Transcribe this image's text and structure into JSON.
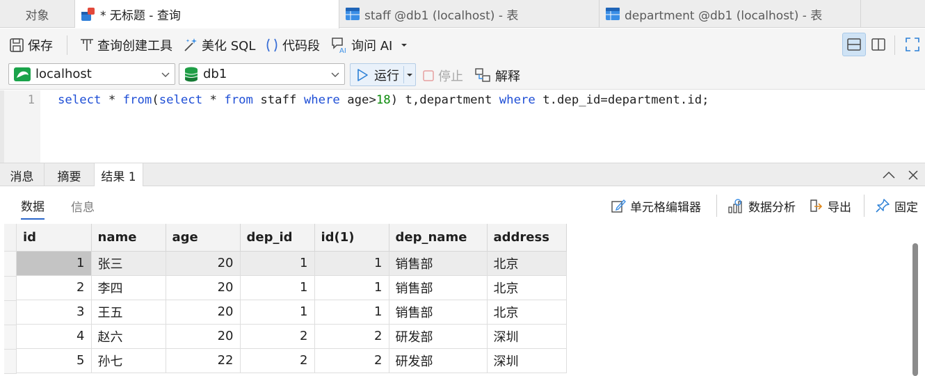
{
  "tabs": {
    "objects": "对象",
    "query": "* 无标题 - 查询",
    "staff": "staff @db1 (localhost) - 表",
    "department": "department @db1 (localhost) - 表"
  },
  "toolbar": {
    "save": "保存",
    "query_builder": "查询创建工具",
    "beautify": "美化 SQL",
    "snippet": "代码段",
    "ask_ai": "询问 AI"
  },
  "connection": {
    "server": "localhost",
    "database": "db1",
    "run": "运行",
    "stop": "停止",
    "explain": "解释"
  },
  "editor": {
    "line_number": "1",
    "tokens": [
      "select",
      " * ",
      "from",
      "(",
      "select",
      " * ",
      "from",
      " staff ",
      "where",
      " age>",
      "18",
      ") t,department ",
      "where",
      " t.dep_id=department.id;"
    ]
  },
  "result_tabs": {
    "messages": "消息",
    "summary": "摘要",
    "result1": "结果 1"
  },
  "sub_tabs": {
    "data": "数据",
    "info": "信息",
    "cell_editor": "单元格编辑器",
    "data_analysis": "数据分析",
    "export": "导出",
    "pin": "固定"
  },
  "grid": {
    "columns": [
      "id",
      "name",
      "age",
      "dep_id",
      "id(1)",
      "dep_name",
      "address"
    ],
    "rows": [
      [
        "1",
        "张三",
        "20",
        "1",
        "1",
        "销售部",
        "北京"
      ],
      [
        "2",
        "李四",
        "20",
        "1",
        "1",
        "销售部",
        "北京"
      ],
      [
        "3",
        "王五",
        "20",
        "1",
        "1",
        "销售部",
        "北京"
      ],
      [
        "4",
        "赵六",
        "20",
        "2",
        "2",
        "研发部",
        "深圳"
      ],
      [
        "5",
        "孙七",
        "22",
        "2",
        "2",
        "研发部",
        "深圳"
      ]
    ]
  },
  "colors": {
    "keyword": "#1f4fd6",
    "number": "#0a8a0a",
    "accent": "#2a66c9"
  }
}
